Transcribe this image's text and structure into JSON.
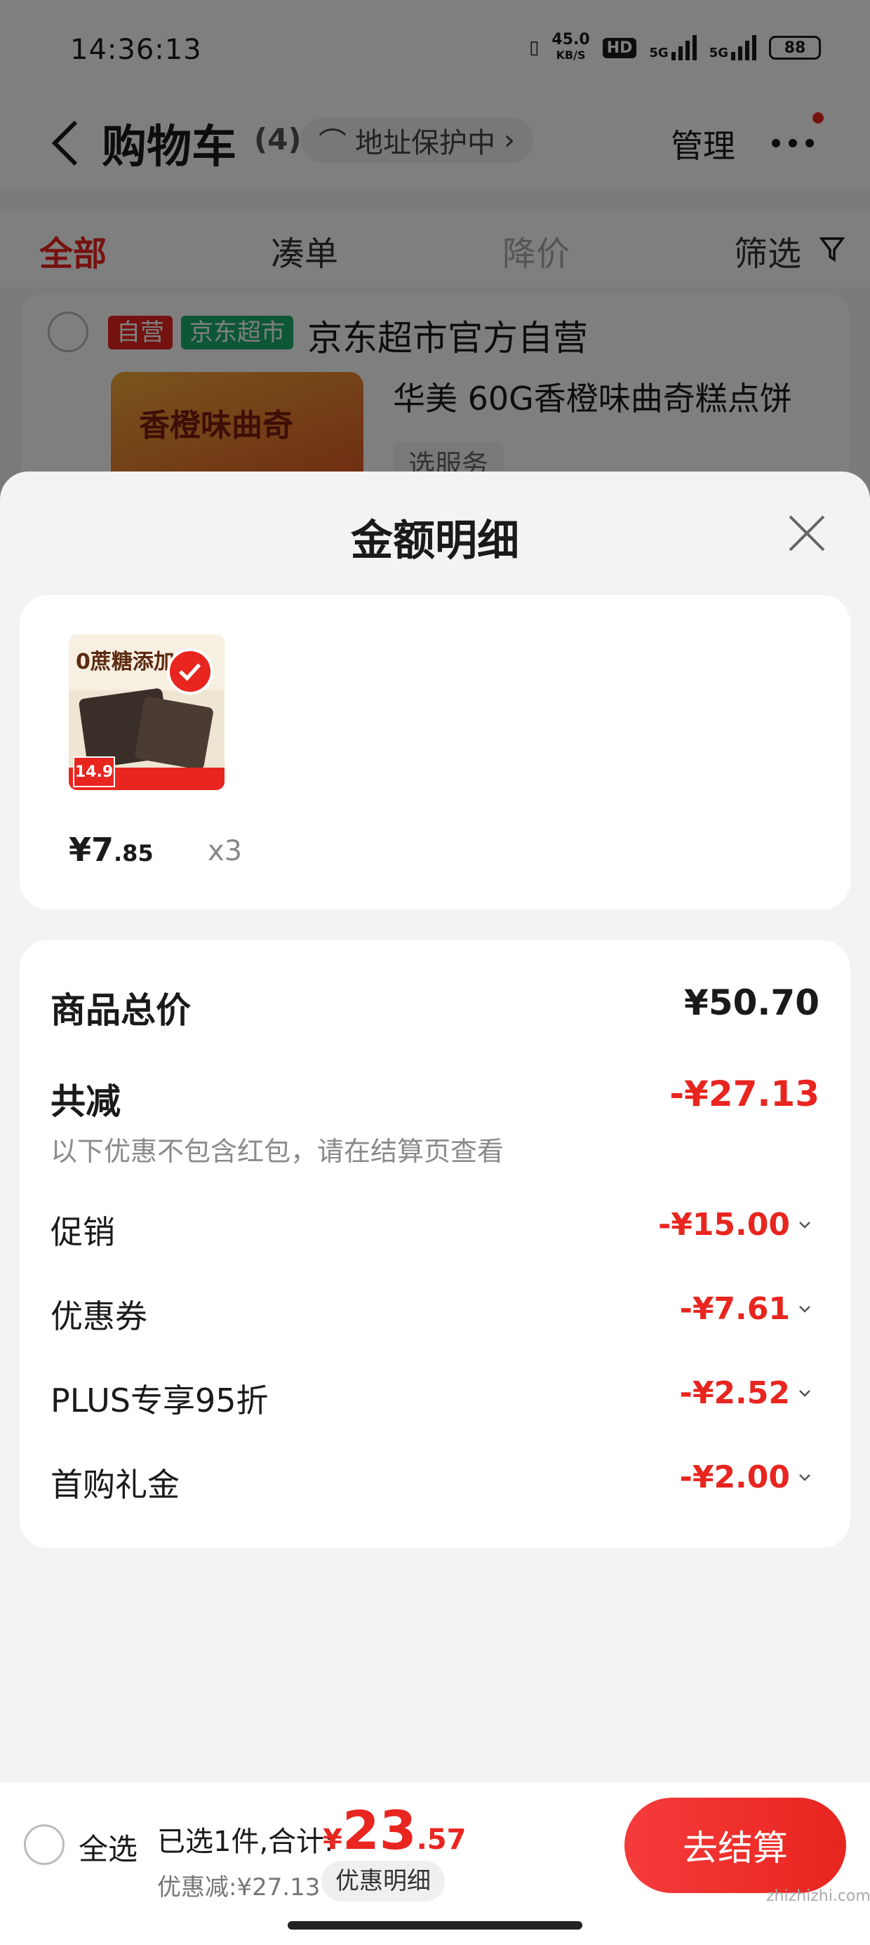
{
  "status_bar": {
    "time": "14:36:13",
    "net_speed": "45.0",
    "net_unit": "KB/S",
    "hd": "HD",
    "sig1": "5G",
    "sig2": "5G",
    "battery": "88"
  },
  "nav": {
    "title": "购物车",
    "count": "(4)",
    "address": "地址保护中",
    "manage": "管理"
  },
  "tabs": [
    "全部",
    "凑单",
    "降价",
    "筛选"
  ],
  "shop": {
    "tag_self": "自营",
    "tag_market": "京东超市",
    "name": "京东超市官方自营",
    "product_name": "华美 60G香橙味曲奇糕点饼",
    "product_img_text": "香橙味曲奇",
    "service": "选服务"
  },
  "sheet": {
    "title": "金额明细",
    "item": {
      "image_text": "0蔗糖添加",
      "image_price": "14.9",
      "price_int": "¥7",
      "price_dec": ".85",
      "qty": "x3"
    },
    "summary": {
      "total_label": "商品总价",
      "total_value": "¥50.70",
      "discount_label": "共减",
      "discount_value": "-¥27.13",
      "note": "以下优惠不包含红包，请在结算页查看",
      "lines": [
        {
          "label": "促销",
          "value": "-¥15.00"
        },
        {
          "label": "优惠券",
          "value": "-¥7.61"
        },
        {
          "label": "PLUS专享95折",
          "value": "-¥2.52"
        },
        {
          "label": "首购礼金",
          "value": "-¥2.00"
        }
      ]
    }
  },
  "bottom": {
    "select_all": "全选",
    "selected_text": "已选1件,合计:",
    "total_cur": "¥",
    "total_int": "23",
    "total_dec": ".57",
    "discount_text": "优惠减:¥27.13",
    "detail_button": "优惠明细",
    "checkout": "去结算"
  },
  "watermark": "zhizhizhi.com",
  "colors": {
    "accent_red": "#e8251f",
    "market_green": "#1aaf6e"
  }
}
